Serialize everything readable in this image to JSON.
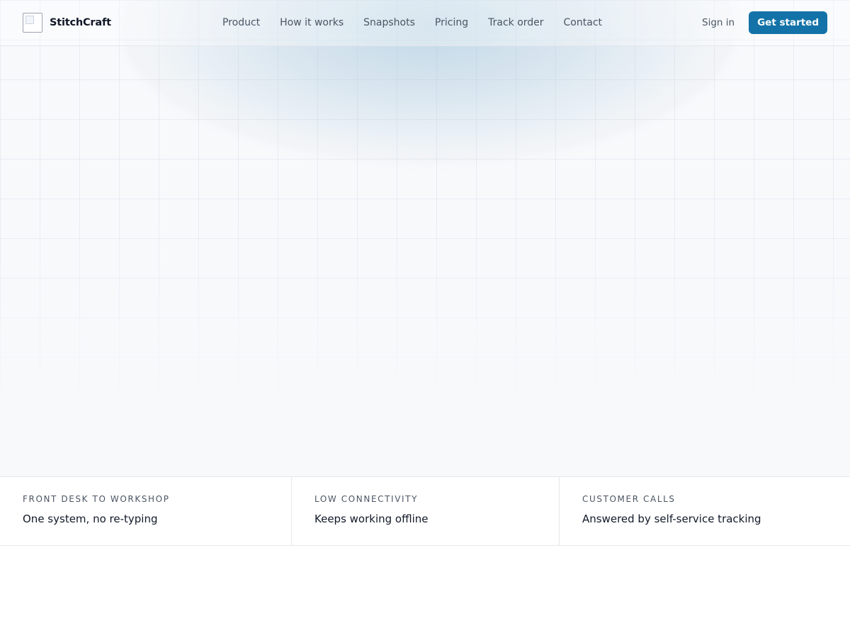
{
  "brand": {
    "name": "StitchCraft",
    "logo_icon": "broken-image-icon"
  },
  "nav": {
    "items": [
      "Product",
      "How it works",
      "Snapshots",
      "Pricing",
      "Track order",
      "Contact"
    ]
  },
  "actions": {
    "sign_in": "Sign in",
    "get_started": "Get started"
  },
  "colors": {
    "accent": "#1373a8",
    "page_bg": "#f8f9fb",
    "border": "#e5e7eb"
  },
  "stats": [
    {
      "label": "FRONT DESK TO WORKSHOP",
      "value": "One system, no re-typing"
    },
    {
      "label": "LOW CONNECTIVITY",
      "value": "Keeps working offline"
    },
    {
      "label": "CUSTOMER CALLS",
      "value": "Answered by self-service tracking"
    }
  ]
}
